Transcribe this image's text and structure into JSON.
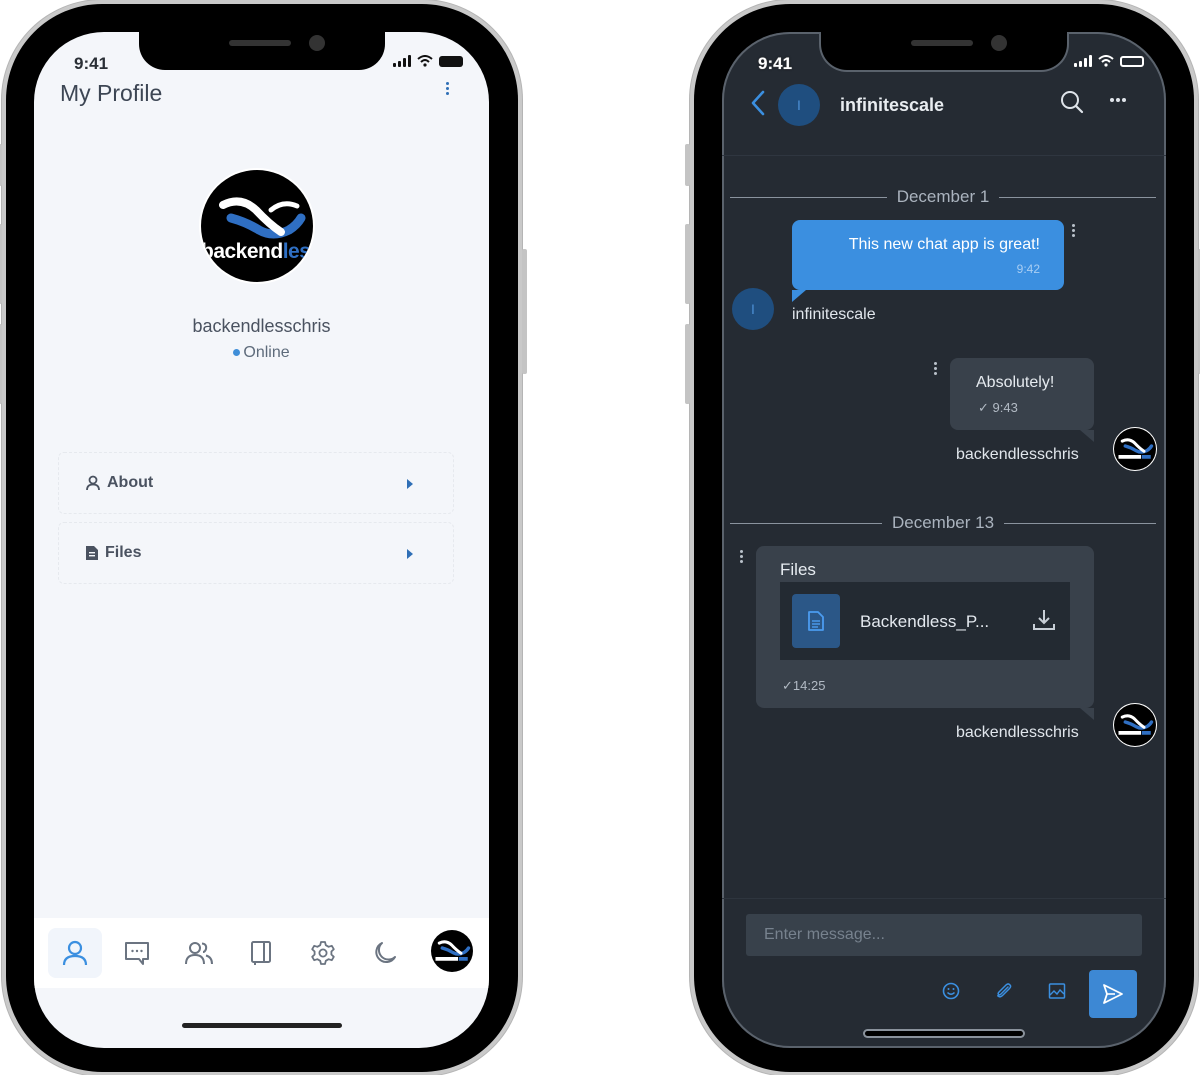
{
  "profile_screen": {
    "status_bar": {
      "time": "9:41"
    },
    "title": "My Profile",
    "menu_icon": "kebab-vertical-icon",
    "user": {
      "avatar": "backendless-logo",
      "avatar_logo_text_white": "backend",
      "avatar_logo_text_blue": "less",
      "username": "backendlesschris",
      "status": "Online"
    },
    "menu_items": [
      {
        "icon": "user-icon",
        "label": "About"
      },
      {
        "icon": "file-icon",
        "label": "Files"
      }
    ],
    "bottom_nav": [
      {
        "icon": "user-icon",
        "label": "Profile",
        "active": true
      },
      {
        "icon": "chat-icon",
        "label": "Chats",
        "active": false
      },
      {
        "icon": "users-icon",
        "label": "Contacts",
        "active": false
      },
      {
        "icon": "book-icon",
        "label": "Notebook",
        "active": false
      },
      {
        "icon": "gear-icon",
        "label": "Settings",
        "active": false
      },
      {
        "icon": "moon-icon",
        "label": "Dark mode",
        "active": false
      },
      {
        "icon": "avatar",
        "label": "Account",
        "active": false
      }
    ],
    "colors": {
      "accent": "#3b8fe0",
      "background": "#f4f6fa",
      "text": "#4a5260"
    }
  },
  "chat_screen": {
    "status_bar": {
      "time": "9:41"
    },
    "header": {
      "back_icon": "chevron-left-icon",
      "avatar_initial": "I",
      "title": "infinitescale",
      "search_icon": "search-icon",
      "more_icon": "more-horizontal-icon"
    },
    "messages": [
      {
        "type": "date",
        "text": "December 1"
      },
      {
        "type": "text",
        "direction": "outgoing-blue",
        "text": "This new chat app is great!",
        "time": "9:42",
        "sender": "infinitescale",
        "sender_initial": "I"
      },
      {
        "type": "text",
        "direction": "incoming-gray",
        "text": "Absolutely!",
        "time": "9:43",
        "read": true,
        "sender": "backendlesschris"
      },
      {
        "type": "date",
        "text": "December 13"
      },
      {
        "type": "file",
        "direction": "incoming-gray",
        "title": "Files",
        "file_name": "Backendless_P...",
        "time": "14:25",
        "read": true,
        "sender": "backendlesschris"
      }
    ],
    "composer": {
      "placeholder": "Enter message...",
      "value": "",
      "tools": [
        "emoji-icon",
        "paperclip-icon",
        "image-icon"
      ],
      "send_icon": "send-icon"
    },
    "colors": {
      "accent": "#3b8fe0",
      "background": "#252b33",
      "bubble_gray": "#39414b"
    }
  }
}
